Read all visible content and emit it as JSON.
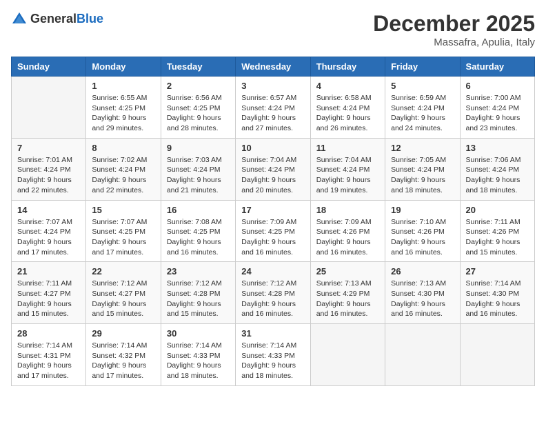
{
  "header": {
    "logo_general": "General",
    "logo_blue": "Blue",
    "month": "December 2025",
    "location": "Massafra, Apulia, Italy"
  },
  "days_of_week": [
    "Sunday",
    "Monday",
    "Tuesday",
    "Wednesday",
    "Thursday",
    "Friday",
    "Saturday"
  ],
  "weeks": [
    [
      {
        "day": "",
        "info": ""
      },
      {
        "day": "1",
        "info": "Sunrise: 6:55 AM\nSunset: 4:25 PM\nDaylight: 9 hours\nand 29 minutes."
      },
      {
        "day": "2",
        "info": "Sunrise: 6:56 AM\nSunset: 4:25 PM\nDaylight: 9 hours\nand 28 minutes."
      },
      {
        "day": "3",
        "info": "Sunrise: 6:57 AM\nSunset: 4:24 PM\nDaylight: 9 hours\nand 27 minutes."
      },
      {
        "day": "4",
        "info": "Sunrise: 6:58 AM\nSunset: 4:24 PM\nDaylight: 9 hours\nand 26 minutes."
      },
      {
        "day": "5",
        "info": "Sunrise: 6:59 AM\nSunset: 4:24 PM\nDaylight: 9 hours\nand 24 minutes."
      },
      {
        "day": "6",
        "info": "Sunrise: 7:00 AM\nSunset: 4:24 PM\nDaylight: 9 hours\nand 23 minutes."
      }
    ],
    [
      {
        "day": "7",
        "info": "Sunrise: 7:01 AM\nSunset: 4:24 PM\nDaylight: 9 hours\nand 22 minutes."
      },
      {
        "day": "8",
        "info": "Sunrise: 7:02 AM\nSunset: 4:24 PM\nDaylight: 9 hours\nand 22 minutes."
      },
      {
        "day": "9",
        "info": "Sunrise: 7:03 AM\nSunset: 4:24 PM\nDaylight: 9 hours\nand 21 minutes."
      },
      {
        "day": "10",
        "info": "Sunrise: 7:04 AM\nSunset: 4:24 PM\nDaylight: 9 hours\nand 20 minutes."
      },
      {
        "day": "11",
        "info": "Sunrise: 7:04 AM\nSunset: 4:24 PM\nDaylight: 9 hours\nand 19 minutes."
      },
      {
        "day": "12",
        "info": "Sunrise: 7:05 AM\nSunset: 4:24 PM\nDaylight: 9 hours\nand 18 minutes."
      },
      {
        "day": "13",
        "info": "Sunrise: 7:06 AM\nSunset: 4:24 PM\nDaylight: 9 hours\nand 18 minutes."
      }
    ],
    [
      {
        "day": "14",
        "info": "Sunrise: 7:07 AM\nSunset: 4:24 PM\nDaylight: 9 hours\nand 17 minutes."
      },
      {
        "day": "15",
        "info": "Sunrise: 7:07 AM\nSunset: 4:25 PM\nDaylight: 9 hours\nand 17 minutes."
      },
      {
        "day": "16",
        "info": "Sunrise: 7:08 AM\nSunset: 4:25 PM\nDaylight: 9 hours\nand 16 minutes."
      },
      {
        "day": "17",
        "info": "Sunrise: 7:09 AM\nSunset: 4:25 PM\nDaylight: 9 hours\nand 16 minutes."
      },
      {
        "day": "18",
        "info": "Sunrise: 7:09 AM\nSunset: 4:26 PM\nDaylight: 9 hours\nand 16 minutes."
      },
      {
        "day": "19",
        "info": "Sunrise: 7:10 AM\nSunset: 4:26 PM\nDaylight: 9 hours\nand 16 minutes."
      },
      {
        "day": "20",
        "info": "Sunrise: 7:11 AM\nSunset: 4:26 PM\nDaylight: 9 hours\nand 15 minutes."
      }
    ],
    [
      {
        "day": "21",
        "info": "Sunrise: 7:11 AM\nSunset: 4:27 PM\nDaylight: 9 hours\nand 15 minutes."
      },
      {
        "day": "22",
        "info": "Sunrise: 7:12 AM\nSunset: 4:27 PM\nDaylight: 9 hours\nand 15 minutes."
      },
      {
        "day": "23",
        "info": "Sunrise: 7:12 AM\nSunset: 4:28 PM\nDaylight: 9 hours\nand 15 minutes."
      },
      {
        "day": "24",
        "info": "Sunrise: 7:12 AM\nSunset: 4:28 PM\nDaylight: 9 hours\nand 16 minutes."
      },
      {
        "day": "25",
        "info": "Sunrise: 7:13 AM\nSunset: 4:29 PM\nDaylight: 9 hours\nand 16 minutes."
      },
      {
        "day": "26",
        "info": "Sunrise: 7:13 AM\nSunset: 4:30 PM\nDaylight: 9 hours\nand 16 minutes."
      },
      {
        "day": "27",
        "info": "Sunrise: 7:14 AM\nSunset: 4:30 PM\nDaylight: 9 hours\nand 16 minutes."
      }
    ],
    [
      {
        "day": "28",
        "info": "Sunrise: 7:14 AM\nSunset: 4:31 PM\nDaylight: 9 hours\nand 17 minutes."
      },
      {
        "day": "29",
        "info": "Sunrise: 7:14 AM\nSunset: 4:32 PM\nDaylight: 9 hours\nand 17 minutes."
      },
      {
        "day": "30",
        "info": "Sunrise: 7:14 AM\nSunset: 4:33 PM\nDaylight: 9 hours\nand 18 minutes."
      },
      {
        "day": "31",
        "info": "Sunrise: 7:14 AM\nSunset: 4:33 PM\nDaylight: 9 hours\nand 18 minutes."
      },
      {
        "day": "",
        "info": ""
      },
      {
        "day": "",
        "info": ""
      },
      {
        "day": "",
        "info": ""
      }
    ]
  ]
}
